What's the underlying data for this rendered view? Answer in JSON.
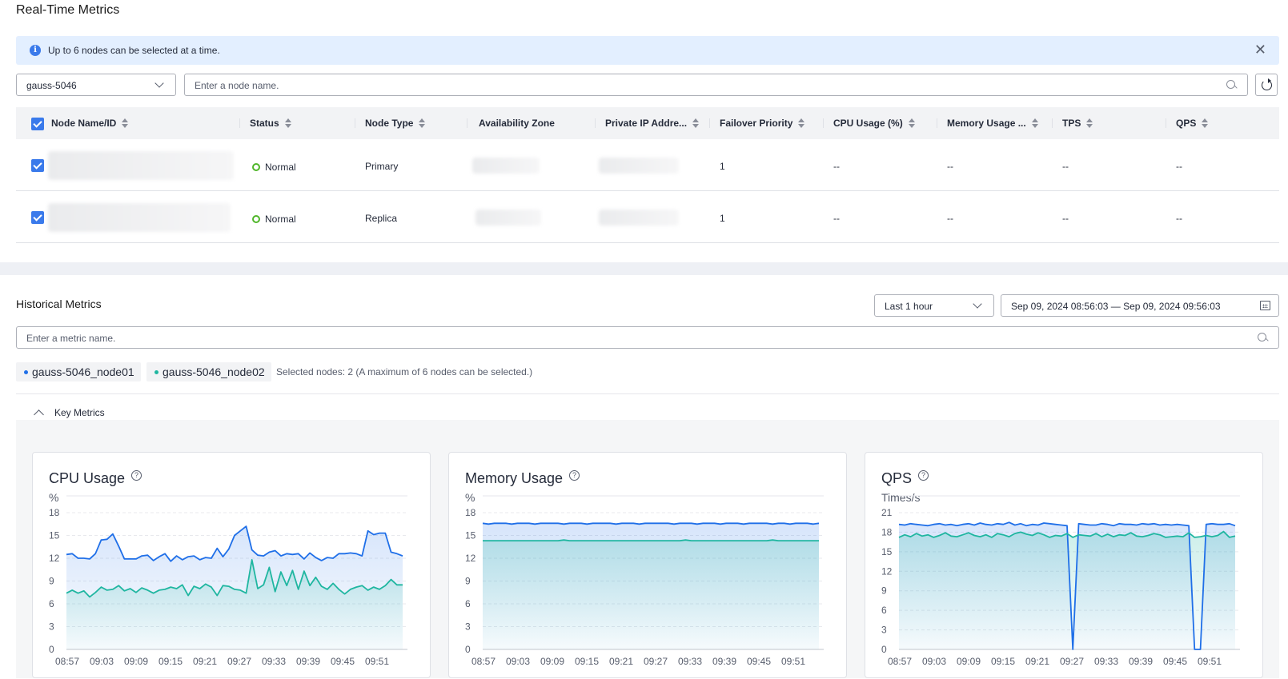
{
  "realtime": {
    "title": "Real-Time Metrics",
    "alert_text": "Up to 6 nodes can be selected at a time.",
    "instance_select": "gauss-5046",
    "node_search_placeholder": "Enter a node name.",
    "columns": [
      "Node Name/ID",
      "Status",
      "Node Type",
      "Availability Zone",
      "Private IP Addre...",
      "Failover Priority",
      "CPU Usage (%)",
      "Memory Usage ...",
      "TPS",
      "QPS"
    ],
    "rows": [
      {
        "status": "Normal",
        "type": "Primary",
        "priority": "1",
        "cpu": "--",
        "memory": "--",
        "tps": "--",
        "qps": "--"
      },
      {
        "status": "Normal",
        "type": "Replica",
        "priority": "1",
        "cpu": "--",
        "memory": "--",
        "tps": "--",
        "qps": "--"
      }
    ]
  },
  "historical": {
    "title": "Historical Metrics",
    "range_select": "Last 1 hour",
    "date_range": "Sep 09, 2024 08:56:03 — Sep 09, 2024 09:56:03",
    "metric_search_placeholder": "Enter a metric name.",
    "selected_nodes": [
      "gauss-5046_node01",
      "gauss-5046_node02"
    ],
    "selected_summary": "Selected nodes: 2 (A maximum of 6 nodes can be selected.)",
    "section_label": "Key Metrics"
  },
  "colors": {
    "primary": "#3a7aeb",
    "node01": "#1f6fe8",
    "node02": "#1fb6a0",
    "ok": "#50b62a"
  },
  "chart_data": [
    {
      "type": "area",
      "title": "CPU Usage",
      "ylabel": "%",
      "ylim": [
        0,
        18
      ],
      "yticks": [
        0,
        3,
        6,
        9,
        12,
        15,
        18
      ],
      "xticks": [
        "08:57",
        "09:03",
        "09:09",
        "09:15",
        "09:21",
        "09:27",
        "09:33",
        "09:39",
        "09:45",
        "09:51"
      ],
      "series": [
        {
          "name": "gauss-5046_node01",
          "values": [
            12.5,
            12.6,
            12,
            12,
            11.9,
            12.6,
            14.4,
            14.5,
            15.2,
            13.6,
            11.9,
            11.9,
            11.9,
            12.3,
            12.4,
            11.7,
            12.2,
            12.6,
            11.6,
            12.3,
            11.8,
            12.2,
            12.3,
            11.8,
            12.1,
            12,
            13.3,
            12.2,
            13.2,
            15,
            15.6,
            16.2,
            13.1,
            12.4,
            12.3,
            12.8,
            13,
            12.3,
            12.6,
            12.5,
            12.6,
            11.9,
            12.7,
            12.1,
            11.7,
            12.1,
            12,
            12.6,
            12.6,
            12.7,
            12.6,
            12.3,
            15.6,
            15.1,
            15.3,
            15.3,
            12.8,
            12.6,
            12.3
          ]
        },
        {
          "name": "gauss-5046_node02",
          "values": [
            7.4,
            7.8,
            7.4,
            7.7,
            6.9,
            7.5,
            8.2,
            7.8,
            7.9,
            8.4,
            7.7,
            8,
            7.5,
            8.1,
            7.8,
            7.4,
            7.8,
            7.9,
            8.2,
            8,
            8.5,
            7.1,
            8.3,
            8,
            8.6,
            8.2,
            7.1,
            8.4,
            8.3,
            7.9,
            7.8,
            7.4,
            11.8,
            8,
            8.5,
            10.8,
            7.6,
            10.2,
            8.4,
            10.4,
            7.9,
            10.3,
            8.4,
            9.5,
            8.3,
            7.9,
            8.7,
            7.9,
            7.3,
            7.9,
            8.2,
            8.4,
            7.8,
            8.2,
            7.9,
            8.4,
            9.2,
            8.5,
            8.5
          ]
        }
      ]
    },
    {
      "type": "area",
      "title": "Memory Usage",
      "ylabel": "%",
      "ylim": [
        0,
        18
      ],
      "yticks": [
        0,
        3,
        6,
        9,
        12,
        15,
        18
      ],
      "xticks": [
        "08:57",
        "09:03",
        "09:09",
        "09:15",
        "09:21",
        "09:27",
        "09:33",
        "09:39",
        "09:45",
        "09:51"
      ],
      "series": [
        {
          "name": "gauss-5046_node01",
          "values": [
            16.6,
            16.5,
            16.6,
            16.6,
            16.6,
            16.5,
            16.6,
            16.6,
            16.6,
            16.5,
            16.6,
            16.6,
            16.6,
            16.6,
            16.5,
            16.6,
            16.6,
            16.6,
            16.5,
            16.6,
            16.6,
            16.6,
            16.6,
            16.5,
            16.6,
            16.6,
            16.6,
            16.5,
            16.6,
            16.6,
            16.6,
            16.6,
            16.6,
            16.5,
            16.6,
            16.6,
            16.6,
            16.5,
            16.6,
            16.6,
            16.6,
            16.5,
            16.6,
            16.6,
            16.6,
            16.5,
            16.6,
            16.6,
            16.6,
            16.6,
            16.5,
            16.6,
            16.6,
            16.5,
            16.6,
            16.6,
            16.6,
            16.5,
            16.6
          ]
        },
        {
          "name": "gauss-5046_node02",
          "values": [
            14.3,
            14.3,
            14.3,
            14.3,
            14.3,
            14.3,
            14.3,
            14.3,
            14.3,
            14.3,
            14.3,
            14.3,
            14.3,
            14.3,
            14.4,
            14.3,
            14.3,
            14.3,
            14.3,
            14.3,
            14.3,
            14.3,
            14.3,
            14.3,
            14.3,
            14.3,
            14.3,
            14.3,
            14.3,
            14.3,
            14.3,
            14.3,
            14.3,
            14.3,
            14.3,
            14.4,
            14.3,
            14.3,
            14.3,
            14.3,
            14.3,
            14.3,
            14.3,
            14.3,
            14.3,
            14.3,
            14.3,
            14.3,
            14.3,
            14.3,
            14.4,
            14.3,
            14.3,
            14.3,
            14.3,
            14.3,
            14.3,
            14.3,
            14.3
          ]
        }
      ]
    },
    {
      "type": "area",
      "title": "QPS",
      "ylabel": "Times/s",
      "ylim": [
        0,
        21
      ],
      "yticks": [
        0,
        3,
        6,
        9,
        12,
        15,
        18,
        21
      ],
      "xticks": [
        "08:57",
        "09:03",
        "09:09",
        "09:15",
        "09:21",
        "09:27",
        "09:33",
        "09:39",
        "09:45",
        "09:51"
      ],
      "series": [
        {
          "name": "gauss-5046_node01",
          "values": [
            19.2,
            19.1,
            19.3,
            19.2,
            19.1,
            19,
            19.2,
            19.3,
            19.1,
            19.2,
            19,
            19.2,
            19.3,
            19.1,
            19.4,
            19.2,
            19.1,
            19.3,
            19.2,
            19.5,
            19.1,
            19.3,
            19,
            19.2,
            19.1,
            19.4,
            19.3,
            19.2,
            19.1,
            19,
            0,
            19.3,
            19.2,
            19.1,
            19.1,
            19.3,
            19.2,
            19,
            19.3,
            19.2,
            19.2,
            19.1,
            19.3,
            19.2,
            19.3,
            19.1,
            19.2,
            19.1,
            19.2,
            19.1,
            19,
            0,
            0,
            19.2,
            19.3,
            19.2,
            19.2,
            19.3,
            19
          ]
        },
        {
          "name": "gauss-5046_node02",
          "values": [
            17.2,
            17.6,
            17.3,
            17.8,
            17.4,
            17.6,
            17.2,
            17.5,
            17.9,
            17.4,
            17.3,
            17.6,
            17.9,
            17.5,
            17.3,
            17.6,
            17.2,
            17.8,
            17.6,
            17.3,
            17.8,
            18,
            17.7,
            17.5,
            17.9,
            17.6,
            17.2,
            17.5,
            17.4,
            17.8,
            17.2,
            17.6,
            17.5,
            17.4,
            17.8,
            17.3,
            17.7,
            17.3,
            17.6,
            17.5,
            17.9,
            17.4,
            17.3,
            17.5,
            17.8,
            17.6,
            17.2,
            17.3,
            17.4,
            17.3,
            17.9,
            17.2,
            17.3,
            17.5,
            17.3,
            17.5,
            18.1,
            17.2,
            17.4
          ]
        }
      ]
    }
  ]
}
